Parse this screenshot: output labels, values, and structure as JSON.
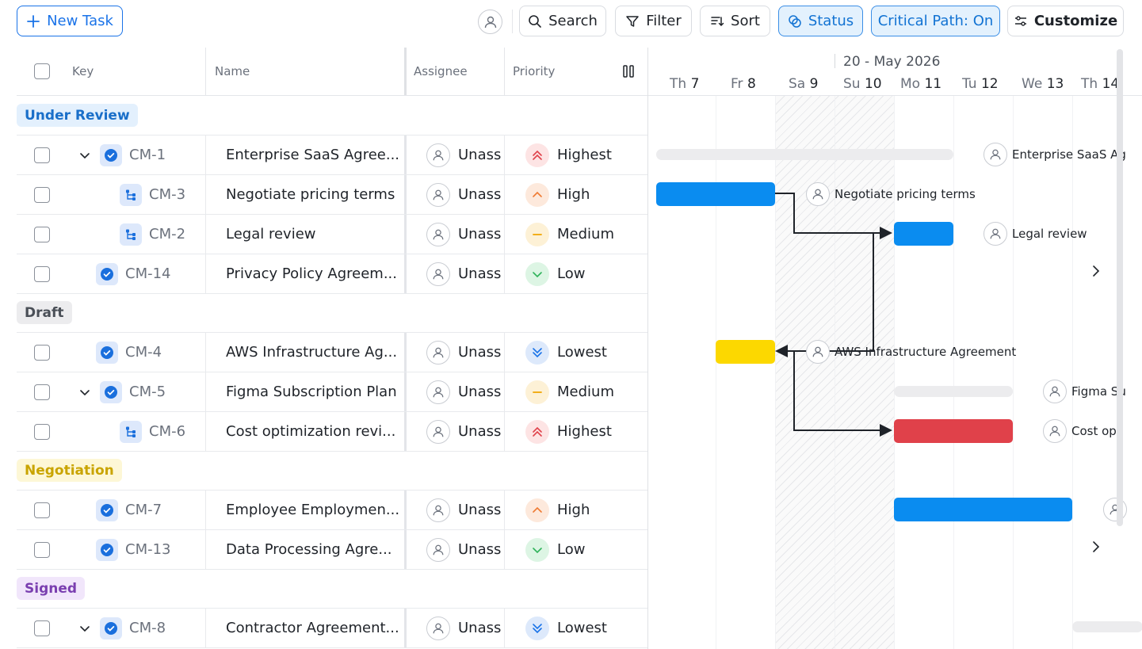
{
  "toolbar": {
    "new_task": "New Task",
    "search": "Search",
    "filter": "Filter",
    "sort": "Sort",
    "status": "Status",
    "critical_path": "Critical Path: On",
    "customize": "Customize"
  },
  "columns": {
    "key": "Key",
    "name": "Name",
    "assignee": "Assignee",
    "priority": "Priority"
  },
  "timeline": {
    "month": "20 - May 2026",
    "days": [
      {
        "dw": "Th",
        "dn": "7"
      },
      {
        "dw": "Fr",
        "dn": "8"
      },
      {
        "dw": "Sa",
        "dn": "9"
      },
      {
        "dw": "Su",
        "dn": "10"
      },
      {
        "dw": "Mo",
        "dn": "11"
      },
      {
        "dw": "Tu",
        "dn": "12"
      },
      {
        "dw": "We",
        "dn": "13"
      },
      {
        "dw": "Th",
        "dn": "14"
      }
    ]
  },
  "groups": {
    "under_review": {
      "label": "Under Review",
      "bg": "#e3f0fd",
      "color": "#1a6fc9"
    },
    "draft": {
      "label": "Draft",
      "bg": "#ececee",
      "color": "#4a4f57"
    },
    "negotiation": {
      "label": "Negotiation",
      "bg": "#fdf7d6",
      "color": "#c9a400"
    },
    "signed": {
      "label": "Signed",
      "bg": "#f1e6fb",
      "color": "#7a3fb0"
    }
  },
  "rows": [
    {
      "key": "CM-1",
      "name": "Enterprise SaaS Agree...",
      "assignee": "Unass",
      "priority": "Highest",
      "gantt_label": "Enterprise SaaS Ag"
    },
    {
      "key": "CM-3",
      "name": "Negotiate pricing terms",
      "assignee": "Unass",
      "priority": "High",
      "gantt_label": "Negotiate pricing terms"
    },
    {
      "key": "CM-2",
      "name": "Legal review",
      "assignee": "Unass",
      "priority": "Medium",
      "gantt_label": "Legal review"
    },
    {
      "key": "CM-14",
      "name": "Privacy Policy Agreem...",
      "assignee": "Unass",
      "priority": "Low"
    },
    {
      "key": "CM-4",
      "name": "AWS Infrastructure Ag...",
      "assignee": "Unass",
      "priority": "Lowest",
      "gantt_label": "AWS Infrastructure Agreement"
    },
    {
      "key": "CM-5",
      "name": "Figma Subscription Plan",
      "assignee": "Unass",
      "priority": "Medium",
      "gantt_label": "Figma Su"
    },
    {
      "key": "CM-6",
      "name": "Cost optimization revi...",
      "assignee": "Unass",
      "priority": "Highest",
      "gantt_label": "Cost opt"
    },
    {
      "key": "CM-7",
      "name": "Employee Employmen...",
      "assignee": "Unass",
      "priority": "High"
    },
    {
      "key": "CM-13",
      "name": "Data Processing Agre...",
      "assignee": "Unass",
      "priority": "Low"
    },
    {
      "key": "CM-8",
      "name": "Contractor Agreement...",
      "assignee": "Unass",
      "priority": "Lowest"
    }
  ],
  "colors": {
    "bar_blue": "#0a8cf0",
    "bar_yellow": "#fcd800",
    "bar_red": "#e0414a",
    "summary_gray": "#ececee",
    "accent": "#1a73e8"
  }
}
